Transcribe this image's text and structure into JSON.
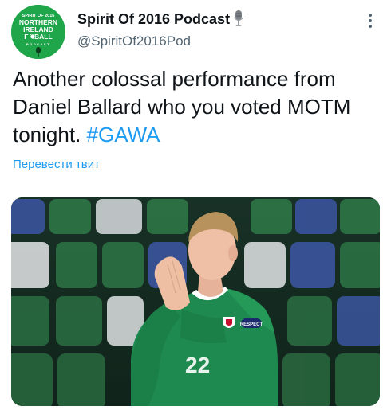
{
  "tweet": {
    "author": {
      "display_name": "Spirit Of 2016 Podcast",
      "handle": "@SpiritOf2016Pod",
      "name_emoji": "microphone-icon",
      "avatar_lines": [
        "SPIRIT OF 2016",
        "NORTHERN",
        "IRELAND",
        "F TBALL",
        "PODCAST"
      ]
    },
    "text": {
      "body": "Another colossal performance from Daniel Ballard who you voted MOTM tonight. ",
      "hashtag": "#GAWA"
    },
    "translate_label": "Перевести твит",
    "more_icon": "more-options-icon",
    "media": {
      "jersey_number": "22",
      "sleeve_patch": "RESPECT"
    }
  },
  "colors": {
    "link_blue": "#1d9bf0",
    "text_primary": "#0f1419",
    "text_secondary": "#536471",
    "avatar_green": "#1fa64a",
    "jersey_green": "#1e8a4f"
  }
}
